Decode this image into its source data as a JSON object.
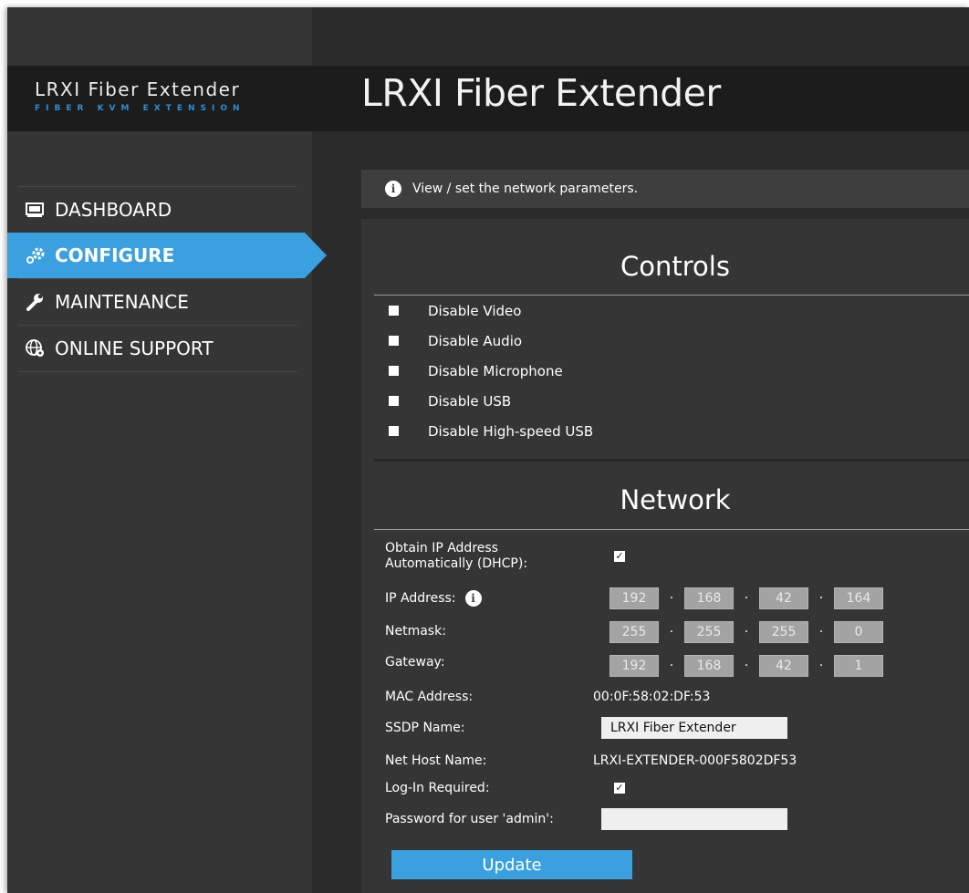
{
  "brand": {
    "title": "LRXI Fiber Extender",
    "subtitle": "FIBER KVM EXTENSION"
  },
  "page": {
    "title": "LRXI Fiber Extender"
  },
  "nav": {
    "items": [
      {
        "label": "DASHBOARD",
        "icon": "monitor-icon",
        "active": false
      },
      {
        "label": "CONFIGURE",
        "icon": "gears-icon",
        "active": true
      },
      {
        "label": "MAINTENANCE",
        "icon": "wrench-icon",
        "active": false
      },
      {
        "label": "ONLINE SUPPORT",
        "icon": "globe-gear-icon",
        "active": false
      }
    ]
  },
  "info": {
    "text": "View / set the network parameters.",
    "icon": "info-icon"
  },
  "controls": {
    "heading": "Controls",
    "items": [
      {
        "label": "Disable Video",
        "checked": false
      },
      {
        "label": "Disable Audio",
        "checked": false
      },
      {
        "label": "Disable Microphone",
        "checked": false
      },
      {
        "label": "Disable USB",
        "checked": false
      },
      {
        "label": "Disable High-speed USB",
        "checked": false
      }
    ]
  },
  "network": {
    "heading": "Network",
    "dhcp": {
      "label_line1": "Obtain IP Address",
      "label_line2": "Automatically (DHCP):",
      "checked": true
    },
    "ip": {
      "label": "IP Address:",
      "octets": [
        "192",
        "168",
        "42",
        "164"
      ]
    },
    "netmask": {
      "label": "Netmask:",
      "octets": [
        "255",
        "255",
        "255",
        "0"
      ]
    },
    "gateway": {
      "label": "Gateway:",
      "octets": [
        "192",
        "168",
        "42",
        "1"
      ]
    },
    "mac": {
      "label": "MAC Address:",
      "value": "00:0F:58:02:DF:53"
    },
    "ssdp": {
      "label": "SSDP Name:",
      "value": "LRXI Fiber Extender"
    },
    "host": {
      "label": "Net Host Name:",
      "value": "LRXI-EXTENDER-000F5802DF53"
    },
    "login": {
      "label": "Log-In Required:",
      "checked": true
    },
    "password": {
      "label": "Password for user 'admin':",
      "value": ""
    },
    "separator": "·",
    "check_mark": "✓",
    "update_label": "Update"
  },
  "colors": {
    "accent": "#3aa0df",
    "brand_sub": "#2b8fd6",
    "background": "#2b2b2b"
  }
}
